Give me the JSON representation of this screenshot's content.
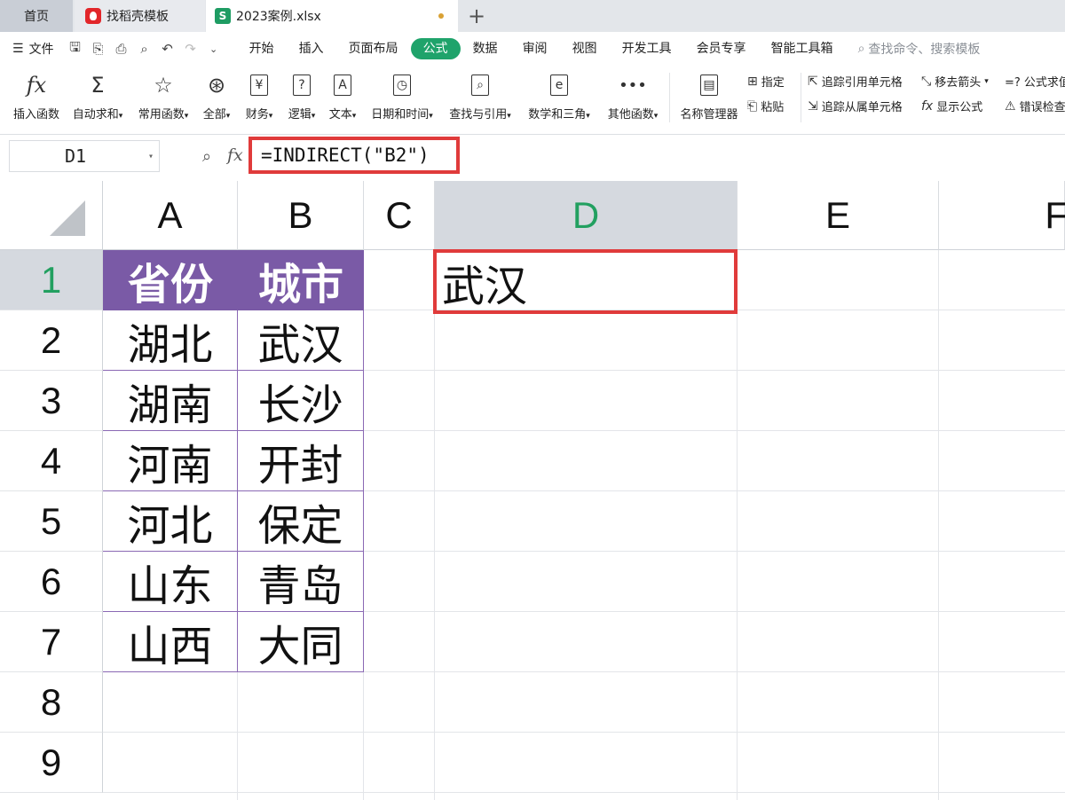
{
  "tabs": {
    "home": "首页",
    "templates": "找稻壳模板",
    "file": "2023案例.xlsx",
    "new_tab": "+"
  },
  "menu": {
    "file": "文件",
    "items": [
      "开始",
      "插入",
      "页面布局",
      "公式",
      "数据",
      "审阅",
      "视图",
      "开发工具",
      "会员专享",
      "智能工具箱"
    ],
    "active": "公式",
    "search_placeholder": "查找命令、搜索模板"
  },
  "ribbon": {
    "insert_function": "插入函数",
    "autosum": "自动求和",
    "common_functions": "常用函数",
    "all": "全部",
    "finance": "财务",
    "logic": "逻辑",
    "text": "文本",
    "datetime": "日期和时间",
    "lookup": "查找与引用",
    "math": "数学和三角",
    "other": "其他函数",
    "name_manager": "名称管理器",
    "specify": "指定",
    "paste": "粘贴",
    "trace_precedents": "追踪引用单元格",
    "trace_dependents": "追踪从属单元格",
    "remove_arrows": "移去箭头",
    "show_formulas": "显示公式",
    "formula_eval": "=? 公式求值",
    "error_check": "错误检查"
  },
  "formula_bar": {
    "name_box": "D1",
    "fx": "fx",
    "formula": "=INDIRECT(\"B2\")"
  },
  "columns": [
    "A",
    "B",
    "C",
    "D",
    "E",
    "F"
  ],
  "selected_column": "D",
  "rows": [
    "1",
    "2",
    "3",
    "4",
    "5",
    "6",
    "7",
    "8",
    "9"
  ],
  "selected_row": "1",
  "table": {
    "headers": [
      "省份",
      "城市"
    ],
    "data": [
      [
        "湖北",
        "武汉"
      ],
      [
        "湖南",
        "长沙"
      ],
      [
        "河南",
        "开封"
      ],
      [
        "河北",
        "保定"
      ],
      [
        "山东",
        "青岛"
      ],
      [
        "山西",
        "大同"
      ]
    ]
  },
  "cell_d1": "武汉",
  "colors": {
    "header_fill": "#7a5aa6",
    "accent_green": "#1fa36b",
    "highlight_red": "#e03b3b"
  }
}
